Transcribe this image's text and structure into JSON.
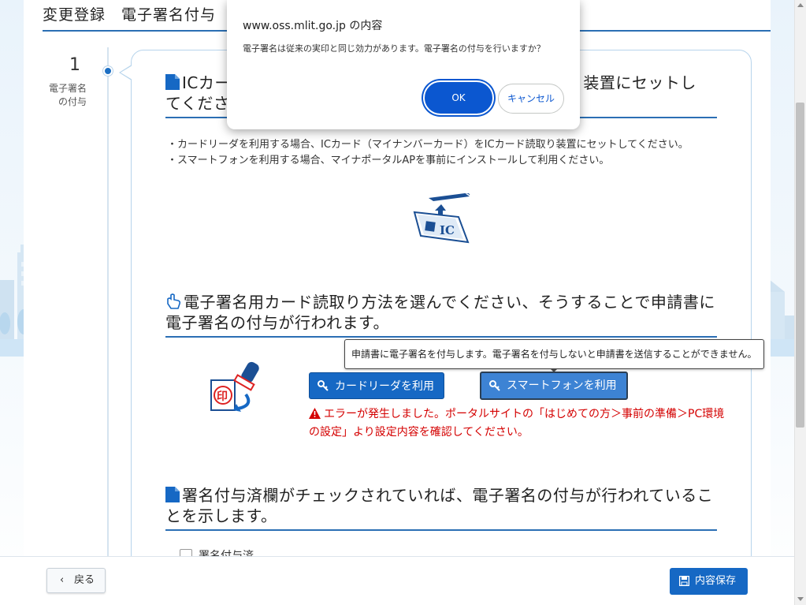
{
  "page": {
    "title": "変更登録　電子署名付与"
  },
  "step": {
    "number": "1",
    "label_line1": "電子署名",
    "label_line2": "の付与"
  },
  "section1": {
    "heading_visible": "ICカー",
    "heading_right": "り装置にセットし",
    "heading_line2": "てくださ",
    "icon": "document-icon",
    "bullet1": "・カードリーダを利用する場合、ICカード（マイナンバーカード）をICカード読取り装置にセットしてください。",
    "bullet2": "・スマートフォンを利用する場合、マイナポータルAPを事前にインストールして利用ください。",
    "illustration_text": "IC"
  },
  "section2": {
    "heading": "電子署名用カード読取り方法を選んでください、そうすることで申請書に電子署名の付与が行われます。",
    "icon": "pointer-hand-icon",
    "stamp_text": "印",
    "btn_card_reader": "カードリーダを利用",
    "btn_smartphone": "スマートフォンを利用",
    "tooltip": "申請書に電子署名を付与します。電子署名を付与しないと申請書を送信することができません。",
    "error": "エラーが発生しました。ポータルサイトの「はじめての方＞事前の準備＞PC環境の設定」より設定内容を確認してください。"
  },
  "section3": {
    "heading": "署名付与済欄がチェックされていれば、電子署名の付与が行われていることを示します。",
    "icon": "document-icon",
    "checkbox_label": "署名付与済"
  },
  "footer": {
    "back_label": "戻る",
    "save_label": "内容保存"
  },
  "dialog": {
    "title": "www.oss.mlit.go.jp の内容",
    "message": "電子署名は従来の実印と同じ効力があります。電子署名の付与を行いますか？",
    "ok_label": "OK",
    "cancel_label": "キャンセル"
  },
  "colors": {
    "accent": "#1668c4",
    "error": "#d40000",
    "dialog_primary": "#0b57d0"
  }
}
